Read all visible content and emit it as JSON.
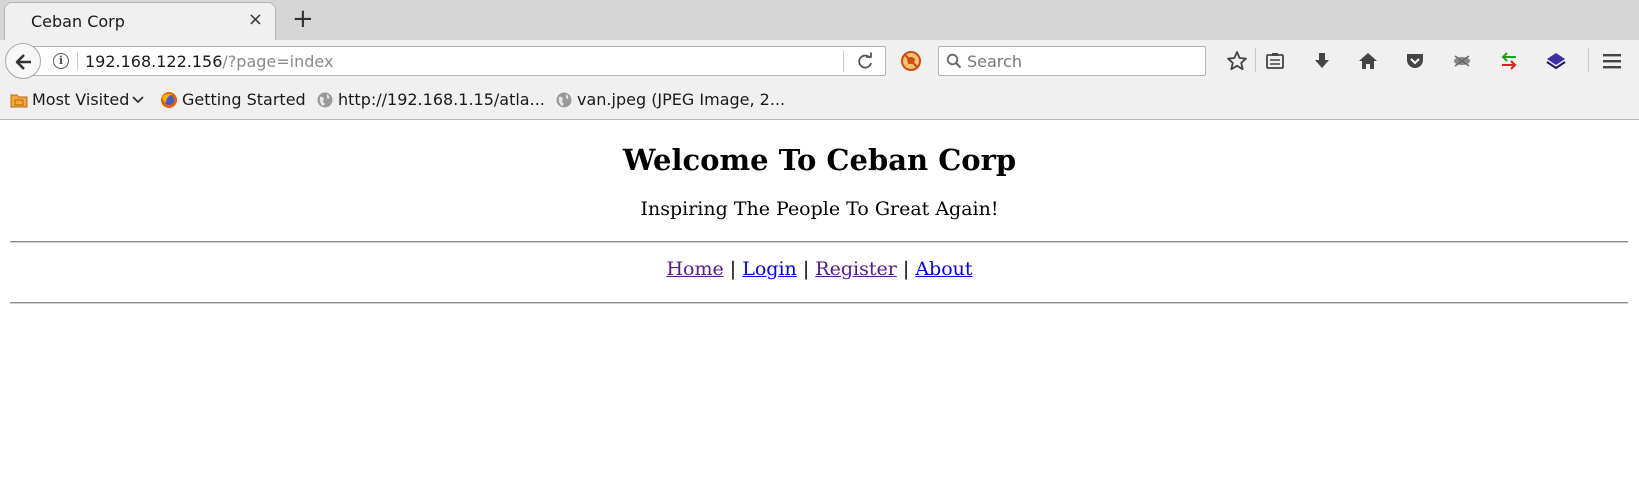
{
  "browser": {
    "tab": {
      "title": "Ceban Corp",
      "close_glyph": "×"
    },
    "new_tab_glyph": "+",
    "address_bar": {
      "host": "192.168.122.156",
      "path": "/?page=index"
    },
    "search": {
      "placeholder": "Search"
    },
    "toolbar_icons": [
      "bookmark-star-icon",
      "reading-list-icon",
      "download-icon",
      "home-icon",
      "pocket-icon",
      "hacker-extension-icon",
      "switch-proxy-icon",
      "layers-extension-icon",
      "menu-icon"
    ],
    "bookmarks": [
      {
        "label": "Most Visited",
        "icon": "folder-icon"
      },
      {
        "label": "Getting Started",
        "icon": "firefox-icon"
      },
      {
        "label": "http://192.168.1.15/atla...",
        "icon": "globe-icon"
      },
      {
        "label": "van.jpeg (JPEG Image, 2...",
        "icon": "globe-icon"
      }
    ]
  },
  "page": {
    "heading": "Welcome To Ceban Corp",
    "tagline": "Inspiring The People To Great Again!",
    "nav_links": [
      {
        "label": "Home",
        "visited": true
      },
      {
        "label": "Login",
        "visited": false
      },
      {
        "label": "Register",
        "visited": true
      },
      {
        "label": "About",
        "visited": false
      }
    ],
    "nav_separator": "|",
    "colors": {
      "visited_link": "#551a8b",
      "unvisited_link": "#0000ee"
    }
  }
}
